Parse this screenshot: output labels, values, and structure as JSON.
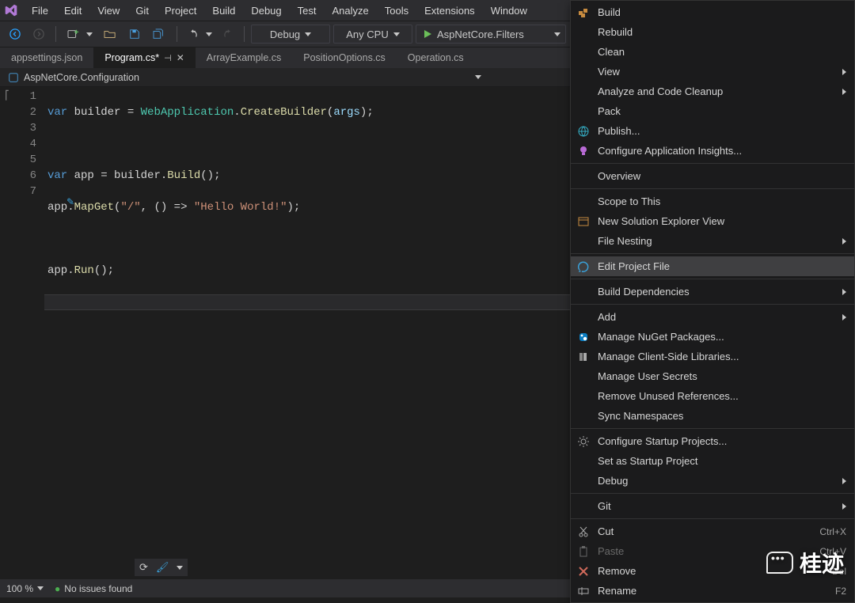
{
  "menubar": {
    "items": [
      "File",
      "Edit",
      "View",
      "Git",
      "Project",
      "Build",
      "Debug",
      "Test",
      "Analyze",
      "Tools",
      "Extensions",
      "Window"
    ]
  },
  "toolbar": {
    "config": "Debug",
    "platform": "Any CPU",
    "startup": "AspNetCore.Filters"
  },
  "tabs": [
    {
      "label": "appsettings.json",
      "active": false
    },
    {
      "label": "Program.cs*",
      "active": true,
      "pinned": true
    },
    {
      "label": "ArrayExample.cs",
      "active": false
    },
    {
      "label": "PositionOptions.cs",
      "active": false
    },
    {
      "label": "Operation.cs",
      "active": false
    }
  ],
  "nav": {
    "class": "AspNetCore.Configuration"
  },
  "code": {
    "lines": [
      1,
      2,
      3,
      4,
      5,
      6,
      7
    ],
    "l1a": "var",
    "l1b": " builder ",
    "l1c": "=",
    "l1d": " WebApplication",
    "l1e": ".",
    "l1f": "CreateBuilder",
    "l1g": "(",
    "l1h": "args",
    "l1i": ");",
    "l3a": "var",
    "l3b": " app ",
    "l3c": "=",
    "l3d": " builder.",
    "l3e": "Build",
    "l3f": "();",
    "l4a": "app.",
    "l4b": "MapGet",
    "l4c": "(",
    "l4d": "\"/\"",
    "l4e": ", () => ",
    "l4f": "\"Hello World!\"",
    "l4g": ");",
    "l6a": "app.",
    "l6b": "Run",
    "l6c": "();"
  },
  "context_menu": {
    "items": [
      {
        "label": "Build",
        "icon": "build-icon"
      },
      {
        "label": "Rebuild"
      },
      {
        "label": "Clean"
      },
      {
        "label": "View",
        "submenu": true
      },
      {
        "label": "Analyze and Code Cleanup",
        "submenu": true
      },
      {
        "label": "Pack"
      },
      {
        "label": "Publish...",
        "icon": "globe-icon"
      },
      {
        "label": "Configure Application Insights...",
        "icon": "bulb-icon"
      },
      {
        "sep": true
      },
      {
        "label": "Overview"
      },
      {
        "sep": true
      },
      {
        "label": "Scope to This"
      },
      {
        "label": "New Solution Explorer View",
        "icon": "window-icon"
      },
      {
        "label": "File Nesting",
        "submenu": true
      },
      {
        "sep": true
      },
      {
        "label": "Edit Project File",
        "icon": "edit-icon",
        "hover": true
      },
      {
        "sep": true
      },
      {
        "label": "Build Dependencies",
        "submenu": true
      },
      {
        "sep": true
      },
      {
        "label": "Add",
        "submenu": true
      },
      {
        "label": "Manage NuGet Packages...",
        "icon": "nuget-icon"
      },
      {
        "label": "Manage Client-Side Libraries...",
        "icon": "lib-icon"
      },
      {
        "label": "Manage User Secrets"
      },
      {
        "label": "Remove Unused References..."
      },
      {
        "label": "Sync Namespaces"
      },
      {
        "sep": true
      },
      {
        "label": "Configure Startup Projects...",
        "icon": "gear-icon"
      },
      {
        "label": "Set as Startup Project"
      },
      {
        "label": "Debug",
        "submenu": true
      },
      {
        "sep": true
      },
      {
        "label": "Git",
        "submenu": true
      },
      {
        "sep": true
      },
      {
        "label": "Cut",
        "icon": "cut-icon",
        "shortcut": "Ctrl+X"
      },
      {
        "label": "Paste",
        "icon": "paste-icon",
        "shortcut": "Ctrl+V",
        "disabled": true
      },
      {
        "label": "Remove",
        "icon": "remove-icon",
        "shortcut": "Del"
      },
      {
        "label": "Rename",
        "icon": "rename-icon",
        "shortcut": "F2"
      }
    ]
  },
  "status": {
    "zoom": "100 %",
    "issues": "No issues found"
  },
  "watermark": "桂迹"
}
